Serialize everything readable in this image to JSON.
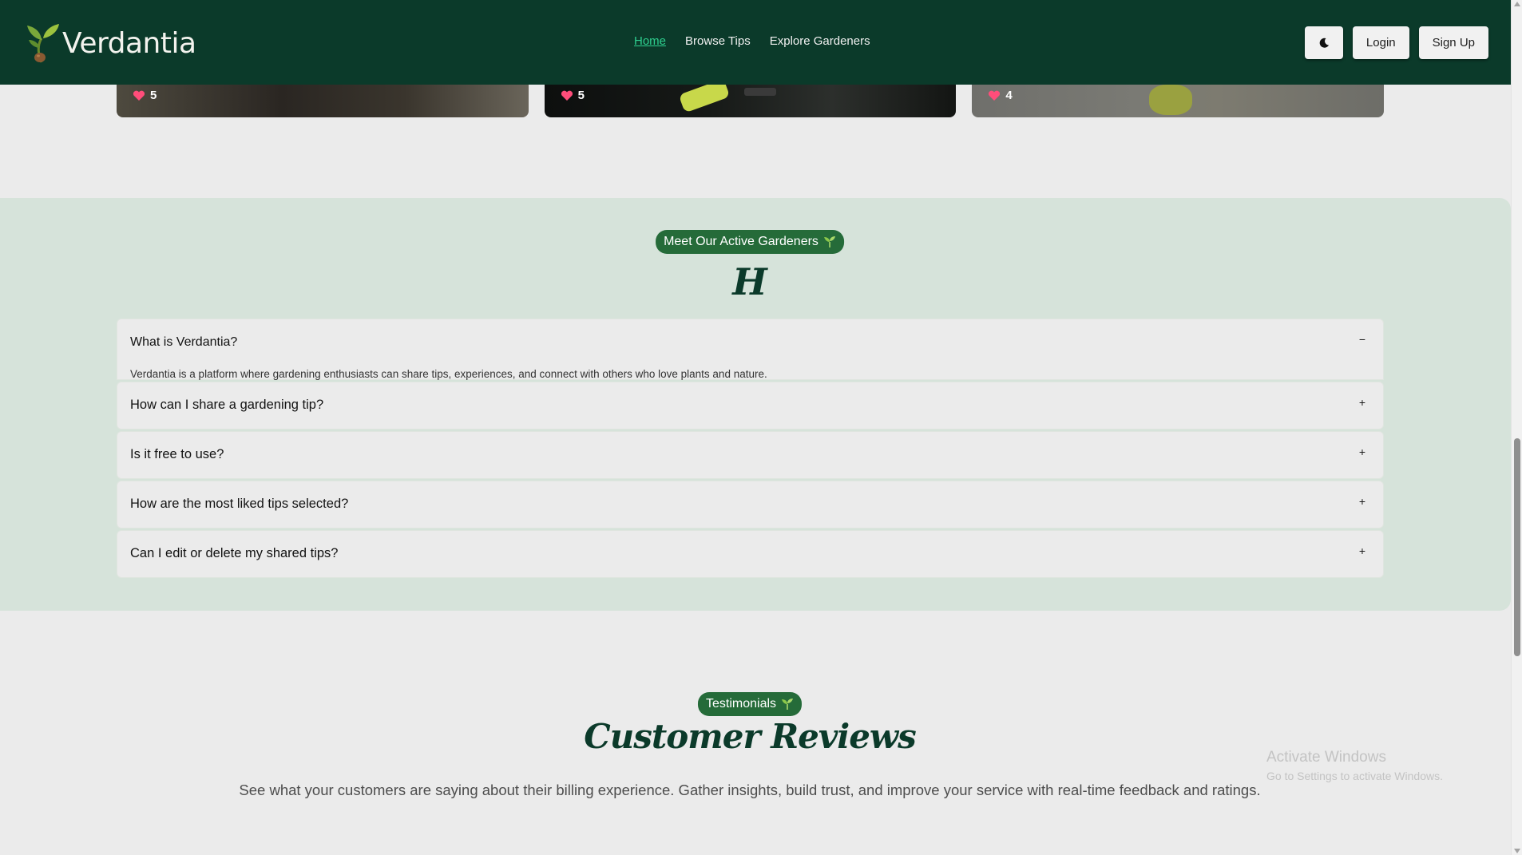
{
  "brand": {
    "name": "Verdantia"
  },
  "nav": {
    "links": [
      "Home",
      "Browse Tips",
      "Explore Gardeners"
    ],
    "active": "Home",
    "login_label": "Login",
    "signup_label": "Sign Up",
    "theme_icon": "moon-icon"
  },
  "tip_cards": [
    {
      "likes": "5"
    },
    {
      "likes": "5"
    },
    {
      "likes": "4"
    }
  ],
  "faq_section": {
    "badge": "Meet Our Active Gardeners",
    "heading": "H",
    "items": [
      {
        "question": "What is Verdantia?",
        "toggle": "−",
        "answer": "Verdantia is a platform where gardening enthusiasts can share tips, experiences, and connect with others who love plants and nature.",
        "open": true
      },
      {
        "question": "How can I share a gardening tip?",
        "toggle": "+",
        "open": false
      },
      {
        "question": "Is it free to use?",
        "toggle": "+",
        "open": false
      },
      {
        "question": "How are the most liked tips selected?",
        "toggle": "+",
        "open": false
      },
      {
        "question": "Can I edit or delete my shared tips?",
        "toggle": "+",
        "open": false
      }
    ]
  },
  "testimonials": {
    "badge": "Testimonials",
    "title": "Customer Reviews",
    "subtitle": "See what your customers are saying about their billing experience. Gather insights, build trust, and improve your service with real-time feedback and ratings."
  },
  "watermark": {
    "title": "Activate Windows",
    "subtitle": "Go to Settings to activate Windows."
  },
  "colors": {
    "navbar": "#0b3a2a",
    "accent_green": "#256b39",
    "active_link": "#2ecf8f",
    "faq_bg": "#d6e3da",
    "page_bg": "#ebebeb"
  }
}
